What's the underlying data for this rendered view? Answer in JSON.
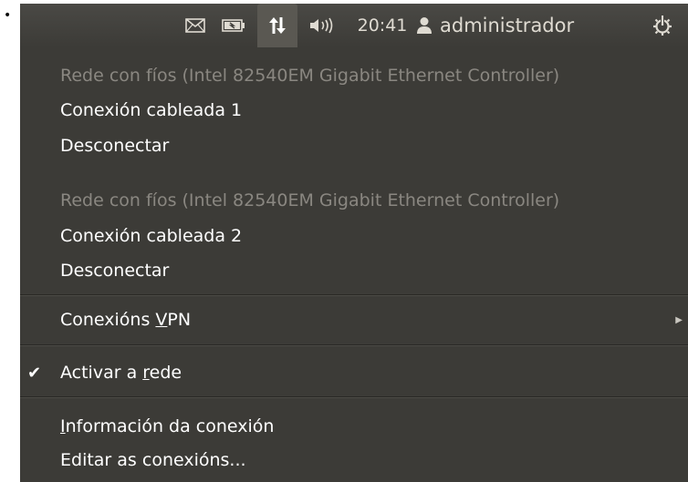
{
  "panel": {
    "icons": {
      "mail": "envelope-icon",
      "battery": "battery-icon",
      "network": "network-updown-arrows-icon",
      "sound": "speaker-icon",
      "user": "person-icon",
      "power": "power-gear-icon"
    },
    "clock": "20:41",
    "user": "administrador"
  },
  "menu": {
    "wired1_header": "Rede con fíos (Intel 82540EM Gigabit Ethernet Controller)",
    "wired1_connection": "Conexión cableada 1",
    "wired1_disconnect": "Desconectar",
    "wired2_header": "Rede con fíos (Intel 82540EM Gigabit Ethernet Controller)",
    "wired2_connection": "Conexión cableada 2",
    "wired2_disconnect": "Desconectar",
    "vpn_before": "Conexións ",
    "vpn_mnemonic": "V",
    "vpn_after": "PN",
    "enable_before": "Activar a ",
    "enable_mnemonic": "r",
    "enable_after": "ede",
    "enable_checked": true,
    "info_mnemonic": "I",
    "info_after": "nformación da conexión",
    "edit": "Editar as conexións..."
  },
  "colors": {
    "panel_bg": "#3c3b37",
    "menu_bg": "#3c3b37",
    "text": "#ffffff",
    "disabled_text": "#8a8781"
  }
}
